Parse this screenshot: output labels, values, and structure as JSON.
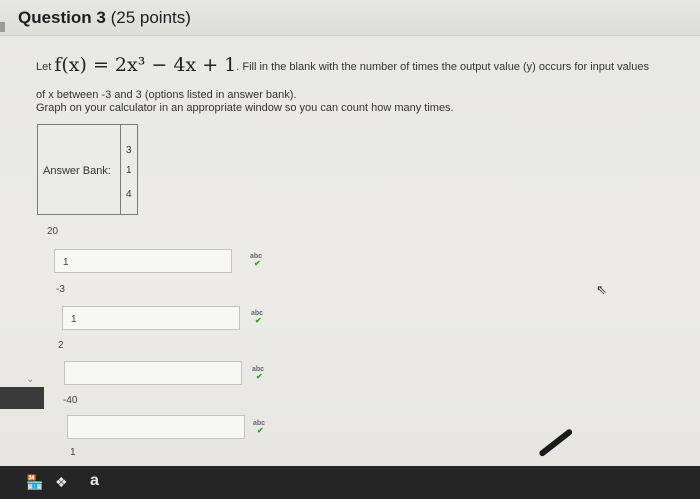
{
  "question": {
    "title_bold": "Question 3",
    "title_points": "(25 points)",
    "prompt_let": "Let",
    "function_math": "f(x) = 2x³ − 4x + 1",
    "prompt_rest": ". Fill in the blank with the number of times the output value (y) occurs for input values",
    "prompt_line2": "of x between -3 and 3 (options listed in answer bank).",
    "prompt_line3": "Graph on your calculator in an appropriate window so you can count how many times."
  },
  "answer_bank": {
    "label": "Answer Bank:",
    "options": [
      "3",
      "1",
      "4"
    ]
  },
  "items": [
    {
      "y_value": "20",
      "answer": "1"
    },
    {
      "y_value": "-3",
      "answer": "1"
    },
    {
      "y_value": "2",
      "answer": ""
    },
    {
      "y_value": "-40",
      "answer": ""
    },
    {
      "y_value": "1",
      "answer": ""
    }
  ],
  "spellcheck_label": "abc",
  "spellcheck_check": "✔",
  "taskbar": {
    "icons": [
      "store-icon",
      "dropbox-icon"
    ],
    "store_glyph": "🏪",
    "dropbox_glyph": "❖",
    "app_letter": "a"
  },
  "cursor_glyph": "⇖"
}
